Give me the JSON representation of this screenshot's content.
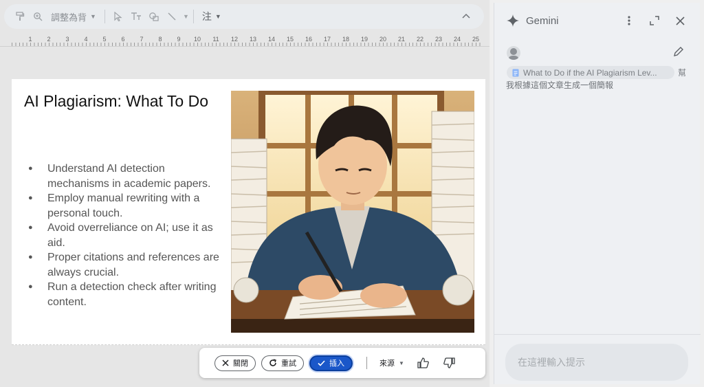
{
  "toolbar": {
    "items": [
      {
        "name": "paint-format-icon",
        "label": ""
      },
      {
        "name": "zoom-icon",
        "label": ""
      },
      {
        "name": "background-select",
        "label": "調整為背"
      },
      {
        "name": "select-cursor-icon",
        "label": ""
      },
      {
        "name": "text-box-icon",
        "label": ""
      },
      {
        "name": "shape-icon",
        "label": ""
      },
      {
        "name": "line-icon",
        "label": ""
      },
      {
        "name": "comment-select",
        "label": "注"
      }
    ],
    "zoom_label": "調整為背",
    "comment_label": "注"
  },
  "ruler": {
    "numbers": [
      "1",
      "2",
      "3",
      "4",
      "5",
      "6",
      "7",
      "8",
      "9",
      "10",
      "11",
      "12",
      "13",
      "14",
      "15",
      "16",
      "17",
      "18",
      "19",
      "20",
      "21",
      "22",
      "23",
      "24",
      "25"
    ]
  },
  "slide": {
    "title": "AI Plagiarism: What To Do",
    "bullets": [
      "Understand AI detection mechanisms in academic papers.",
      "Employ manual rewriting with a personal touch.",
      "Avoid overreliance on AI; use it as aid.",
      "Proper citations and references are always crucial.",
      "Run a detection check after writing content."
    ],
    "image_alt": "Illustration of a young man writing on paper at a desk surrounded by stacks of papers"
  },
  "action_bar": {
    "close_label": "關閉",
    "retry_label": "重試",
    "insert_label": "插入",
    "source_label": "來源"
  },
  "gemini": {
    "title": "Gemini",
    "chip_text": "What to Do if the AI Plagiarism Lev...",
    "chip_suffix": "幫",
    "prompt_text": "我根據這個文章生成一個簡報",
    "input_placeholder": "在這裡輸入提示"
  },
  "colors": {
    "accent": "#1a57c9",
    "panel_bg": "#eef0f3",
    "slide_bg": "#ffffff"
  }
}
